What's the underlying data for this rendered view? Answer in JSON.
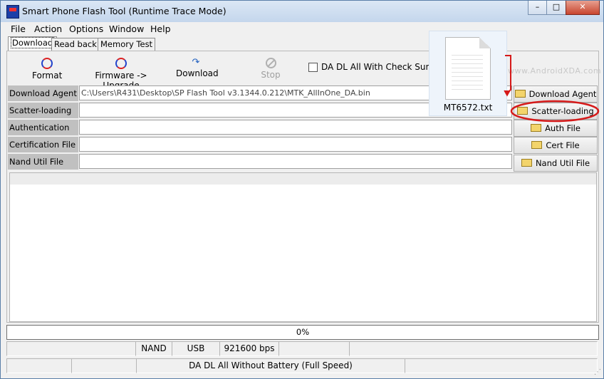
{
  "window": {
    "title": "Smart Phone Flash Tool (Runtime Trace Mode)"
  },
  "title_buttons": {
    "minimize": "–",
    "maximize": "□",
    "close": "✕"
  },
  "menu": [
    "File",
    "Action",
    "Options",
    "Window",
    "Help"
  ],
  "tabs": [
    "Download",
    "Read back",
    "Memory Test"
  ],
  "toolbar": {
    "format": "Format",
    "firmware_upgrade": "Firmware -> Upgrade",
    "download": "Download",
    "stop": "Stop",
    "checksum_label": "DA DL All With Check Sum",
    "checksum_checked": false
  },
  "fields": [
    {
      "label": "Download Agent",
      "value": "C:\\Users\\R431\\Desktop\\SP Flash Tool v3.1344.0.212\\MTK_AllInOne_DA.bin",
      "button": "Download Agent"
    },
    {
      "label": "Scatter-loading File",
      "value": "",
      "button": "Scatter-loading"
    },
    {
      "label": "Authentication File",
      "value": "",
      "button": "Auth File"
    },
    {
      "label": "Certification File",
      "value": "",
      "button": "Cert File"
    },
    {
      "label": "Nand Util File",
      "value": "",
      "button": "Nand Util File"
    }
  ],
  "progress": {
    "text": "0%",
    "value": 0
  },
  "status": {
    "storage": "NAND",
    "connection": "USB",
    "baud": "921600 bps",
    "mode": "DA DL All Without Battery (Full Speed)"
  },
  "overlay": {
    "file_name": "MT6572.txt",
    "watermark": "www.AndroidXDA.com"
  },
  "colors": {
    "annotation": "#d61a1a"
  }
}
